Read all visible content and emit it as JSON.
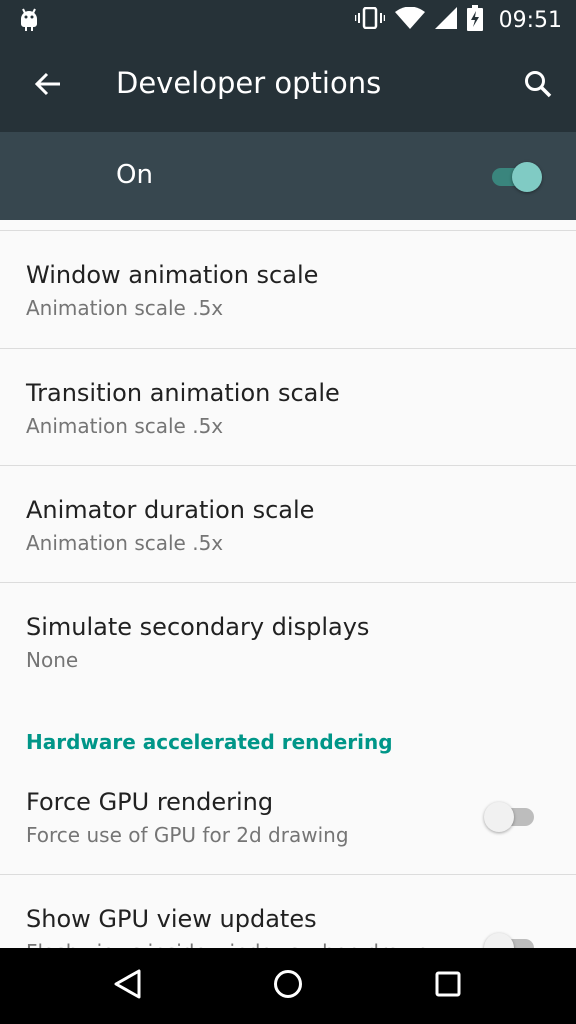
{
  "status_bar": {
    "time": "09:51",
    "icons": [
      "android-icon",
      "vibrate-icon",
      "wifi-icon",
      "signal-icon",
      "battery-charging-icon"
    ]
  },
  "app_bar": {
    "title": "Developer options",
    "back_icon": "arrow-back-icon",
    "search_icon": "search-icon"
  },
  "master_switch": {
    "label": "On",
    "state": "on",
    "accent": "#80cbc4"
  },
  "preferences": [
    {
      "title": "Window animation scale",
      "summary": "Animation scale .5x"
    },
    {
      "title": "Transition animation scale",
      "summary": "Animation scale .5x"
    },
    {
      "title": "Animator duration scale",
      "summary": "Animation scale .5x"
    },
    {
      "title": "Simulate secondary displays",
      "summary": "None"
    }
  ],
  "section": {
    "header": "Hardware accelerated rendering",
    "color": "#009688",
    "items": [
      {
        "title": "Force GPU rendering",
        "summary": "Force use of GPU for 2d drawing",
        "switch": "off"
      },
      {
        "title": "Show GPU view updates",
        "summary": "Flash views inside windows when drawn",
        "switch": "off"
      }
    ]
  },
  "colors": {
    "app_bar": "#263238",
    "master_bar": "#37474f"
  },
  "nav_bar": {
    "buttons": [
      "back-triangle-icon",
      "home-circle-icon",
      "recents-square-icon"
    ]
  }
}
